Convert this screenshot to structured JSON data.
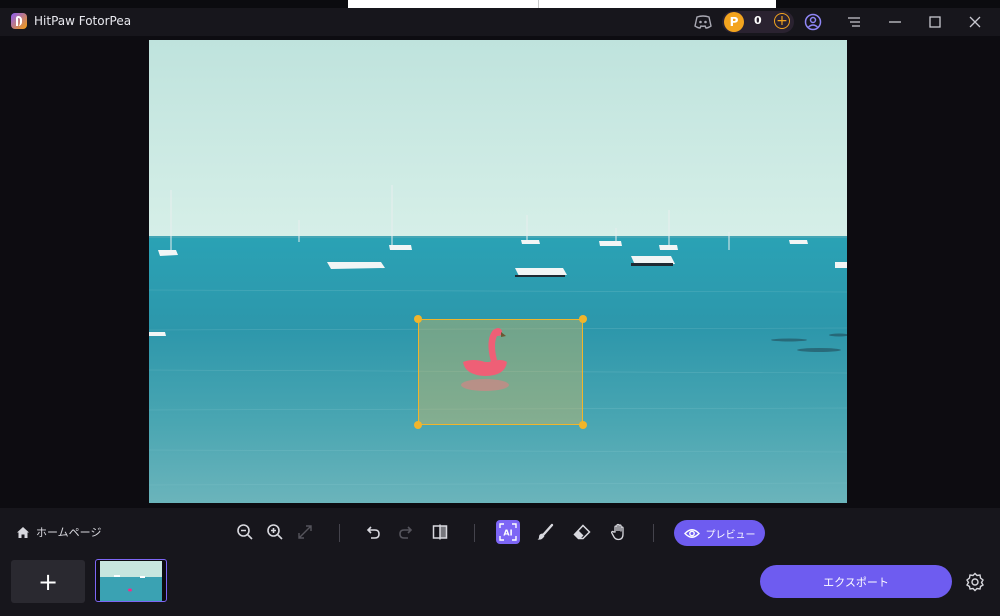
{
  "app": {
    "title": "HitPaw FotorPea"
  },
  "account": {
    "coins": "0"
  },
  "toolbar": {
    "home_label": "ホームページ",
    "preview_label": "プレビュー"
  },
  "actions": {
    "add_label": "+",
    "export_label": "エクスポート"
  },
  "colors": {
    "accent": "#6E5CF0",
    "selection": "#F1B52B",
    "coin": "#F3A41F"
  },
  "icons": {
    "titlebar": [
      "discord-icon",
      "coin-icon",
      "add-coins-icon",
      "user-icon",
      "menu-icon",
      "minimize-icon",
      "maximize-icon",
      "close-icon"
    ],
    "toolbar": [
      "home-icon",
      "zoom-out-icon",
      "zoom-in-icon",
      "fit-screen-icon",
      "undo-icon",
      "redo-icon",
      "compare-icon",
      "ai-select-icon",
      "brush-icon",
      "eraser-icon",
      "hand-icon",
      "eye-icon"
    ],
    "bottom": [
      "gear-icon"
    ]
  }
}
